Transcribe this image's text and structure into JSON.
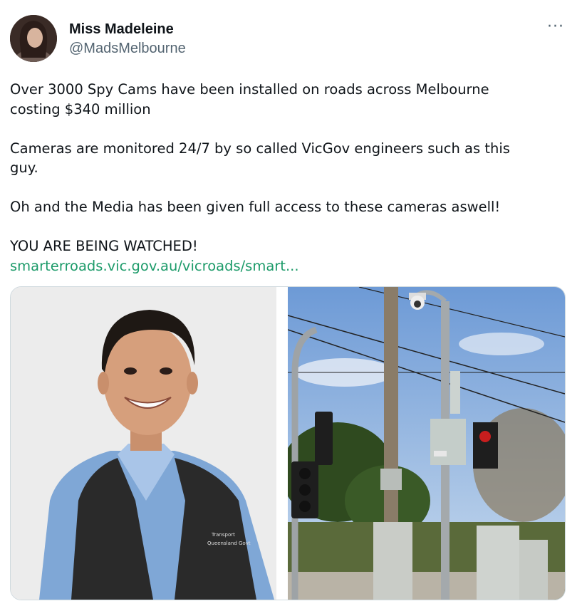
{
  "author": {
    "display_name": "Miss Madeleine",
    "handle": "@MadsMelbourne",
    "avatar_icon": "profile-photo"
  },
  "more_menu": {
    "glyph": "···",
    "icon": "more-options-icon"
  },
  "tweet": {
    "paragraphs": [
      "Over 3000 Spy Cams have been installed on roads across Melbourne\ncosting $340 million",
      "Cameras are monitored 24/7 by so called VicGov engineers such as this\nguy.",
      "Oh and the Media has been given full access to these cameras aswell!",
      "YOU ARE BEING WATCHED!"
    ],
    "link_text": "smarterroads.vic.gov.au/vicroads/smart..."
  },
  "media": {
    "left_vest_logo_line1": "Transport",
    "left_vest_logo_line2": "Queensland Govt"
  },
  "colors": {
    "link": "#1d9b6a",
    "secondary_text": "#536471",
    "primary_text": "#0f1419"
  }
}
